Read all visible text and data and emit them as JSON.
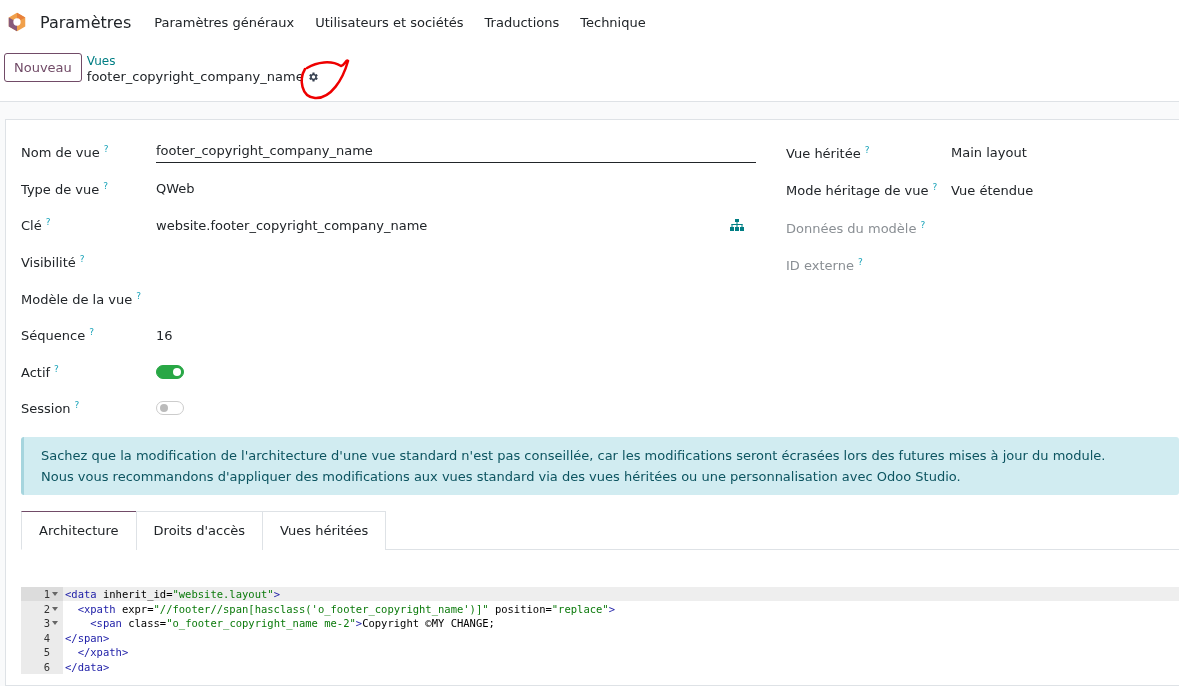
{
  "navbar": {
    "app": "Paramètres",
    "menu": [
      "Paramètres généraux",
      "Utilisateurs et sociétés",
      "Traductions",
      "Technique"
    ]
  },
  "control_panel": {
    "new_button": "Nouveau",
    "breadcrumb": "Vues",
    "record_title": "footer_copyright_company_name",
    "annotation": true
  },
  "form": {
    "left_fields": [
      {
        "label": "Nom de vue",
        "help": "?",
        "kind": "input",
        "value": "footer_copyright_company_name"
      },
      {
        "label": "Type de vue",
        "help": "?",
        "kind": "text",
        "value": "QWeb"
      },
      {
        "label": "Clé",
        "help": "?",
        "kind": "text",
        "value": "website.footer_copyright_company_name",
        "hierarchy_button": true
      },
      {
        "label": "Visibilité",
        "help": "?",
        "kind": "empty"
      },
      {
        "label": "Modèle de la vue",
        "help": "?",
        "kind": "empty"
      },
      {
        "label": "Séquence",
        "help": "?",
        "kind": "text",
        "value": "16"
      },
      {
        "label": "Actif",
        "help": "?",
        "kind": "toggle",
        "on": true
      },
      {
        "label": "Session",
        "help": "?",
        "kind": "toggle",
        "on": false
      }
    ],
    "right_fields": [
      {
        "label": "Vue héritée",
        "help": "?",
        "readonly": false,
        "value": "Main layout"
      },
      {
        "label": "Mode héritage de vue",
        "help": "?",
        "readonly": false,
        "value": "Vue étendue"
      },
      {
        "label": "Données du modèle",
        "help": "?",
        "readonly": true
      },
      {
        "label": "ID externe",
        "help": "?",
        "readonly": true
      }
    ],
    "alert": [
      "Sachez que la modification de l'architecture d'une vue standard n'est pas conseillée, car les modifications seront écrasées lors des futures mises à jour du module.",
      "Nous vous recommandons d'appliquer des modifications aux vues standard via des vues héritées ou une personnalisation avec Odoo Studio."
    ],
    "tabs": [
      {
        "label": "Architecture",
        "selected": true
      },
      {
        "label": "Droits d'accès",
        "selected": false
      },
      {
        "label": "Vues héritées",
        "selected": false
      }
    ],
    "code": [
      {
        "number": "1",
        "foldable": true,
        "active": true,
        "tokens": [
          {
            "kind": "tag",
            "text": "<data"
          },
          {
            "kind": "attr",
            "text": " inherit_id="
          },
          {
            "kind": "string",
            "text": "\"website.layout\""
          },
          {
            "kind": "tag",
            "text": ">"
          }
        ]
      },
      {
        "number": "2",
        "foldable": true,
        "active": false,
        "tokens": [
          {
            "kind": "tag",
            "text": "  <xpath"
          },
          {
            "kind": "attr",
            "text": " expr="
          },
          {
            "kind": "string",
            "text": "\"//footer//span[hasclass('o_footer_copyright_name')]\""
          },
          {
            "kind": "attr",
            "text": " position="
          },
          {
            "kind": "string",
            "text": "\"replace\""
          },
          {
            "kind": "tag",
            "text": ">"
          }
        ]
      },
      {
        "number": "3",
        "foldable": true,
        "active": false,
        "tokens": [
          {
            "kind": "tag",
            "text": "    <span"
          },
          {
            "kind": "attr",
            "text": " class="
          },
          {
            "kind": "string",
            "text": "\"o_footer_copyright_name me-2\""
          },
          {
            "kind": "tag",
            "text": ">"
          },
          {
            "kind": "text",
            "text": "Copyright ©MY CHANGE;"
          }
        ]
      },
      {
        "number": "4",
        "foldable": false,
        "active": false,
        "tokens": [
          {
            "kind": "tag",
            "text": "</span>"
          }
        ]
      },
      {
        "number": "5",
        "foldable": false,
        "active": false,
        "tokens": [
          {
            "kind": "tag",
            "text": "  </xpath>"
          }
        ]
      },
      {
        "number": "6",
        "foldable": false,
        "active": false,
        "tokens": [
          {
            "kind": "tag",
            "text": "</data>"
          }
        ]
      }
    ]
  }
}
